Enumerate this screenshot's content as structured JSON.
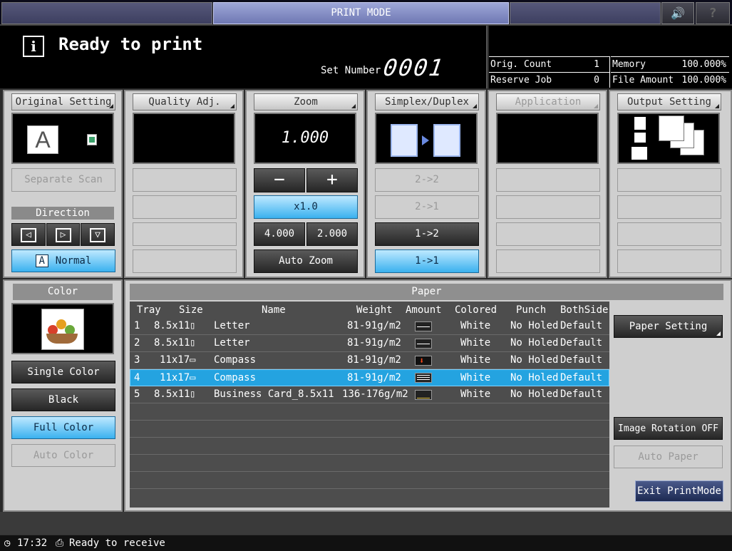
{
  "title": "PRINT MODE",
  "status": {
    "message": "Ready to print",
    "set_number_label": "Set Number",
    "set_number": "0001"
  },
  "counts": {
    "orig_count_label": "Orig. Count",
    "orig_count": "1",
    "reserve_job_label": "Reserve Job",
    "reserve_job": "0",
    "memory_label": "Memory",
    "memory": "100.000%",
    "file_amount_label": "File Amount",
    "file_amount": "100.000%"
  },
  "original_setting": {
    "label": "Original Setting",
    "separate_scan": "Separate Scan",
    "direction": "Direction",
    "normal": "Normal"
  },
  "quality": {
    "label": "Quality Adj."
  },
  "zoom": {
    "label": "Zoom",
    "value": "1.000",
    "minus": "−",
    "plus": "+",
    "x10": "x1.0",
    "preset1": "4.000",
    "preset2": "2.000",
    "auto": "Auto Zoom"
  },
  "duplex": {
    "label": "Simplex/Duplex",
    "opt1": "2->2",
    "opt2": "2->1",
    "opt3": "1->2",
    "opt4": "1->1"
  },
  "application": {
    "label": "Application"
  },
  "output": {
    "label": "Output Setting"
  },
  "color": {
    "label": "Color",
    "single": "Single Color",
    "black": "Black",
    "full": "Full Color",
    "auto": "Auto Color"
  },
  "paper": {
    "label": "Paper",
    "headers": {
      "tray": "Tray",
      "size": "Size",
      "name": "Name",
      "weight": "Weight",
      "amount": "Amount",
      "colored": "Colored",
      "punch": "Punch",
      "bothside": "BothSide"
    },
    "rows": [
      {
        "tray": "1",
        "size": "8.5x11",
        "name": "Letter",
        "weight": "81-91g/m2",
        "amount": "mid",
        "colored": "White",
        "punch": "No Holed",
        "bothside": "Default"
      },
      {
        "tray": "2",
        "size": "8.5x11",
        "name": "Letter",
        "weight": "81-91g/m2",
        "amount": "mid",
        "colored": "White",
        "punch": "No Holed",
        "bothside": "Default"
      },
      {
        "tray": "3",
        "size": "11x17",
        "name": "Compass",
        "weight": "81-91g/m2",
        "amount": "empty",
        "colored": "White",
        "punch": "No Holed",
        "bothside": "Default"
      },
      {
        "tray": "4",
        "size": "11x17",
        "name": "Compass",
        "weight": "81-91g/m2",
        "amount": "full",
        "colored": "White",
        "punch": "No Holed",
        "bothside": "Default"
      },
      {
        "tray": "5",
        "size": "8.5x11",
        "name": "Business Card_8.5x11",
        "weight": "136-176g/m2",
        "amount": "low",
        "colored": "White",
        "punch": "No Holed",
        "bothside": "Default"
      }
    ],
    "setting_btn": "Paper Setting",
    "rotation_btn": "Image Rotation OFF",
    "auto_paper_btn": "Auto Paper",
    "exit_btn": "Exit PrintMode"
  },
  "footer": {
    "time": "17:32",
    "message": "Ready to receive"
  }
}
